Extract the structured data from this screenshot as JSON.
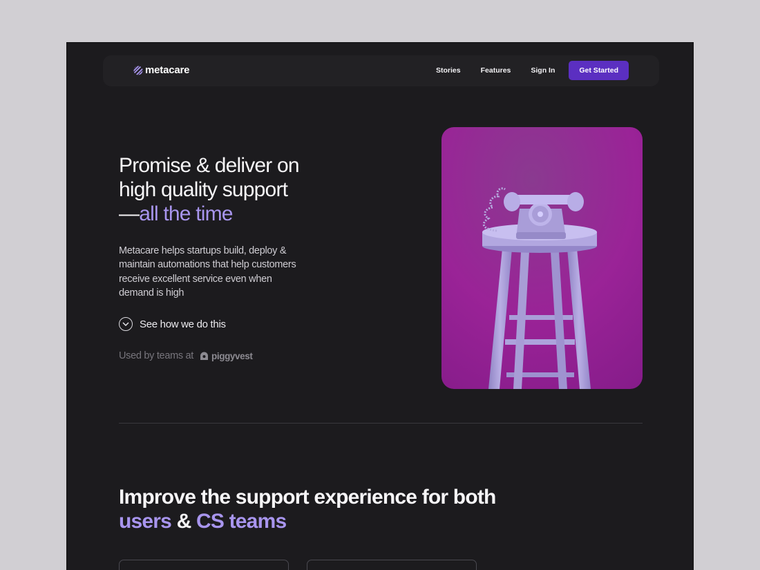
{
  "brand": {
    "name": "metacare"
  },
  "nav": {
    "links": [
      "Stories",
      "Features",
      "Sign In"
    ],
    "cta": "Get Started"
  },
  "hero": {
    "title_line1": "Promise & deliver on",
    "title_line2": "high quality support",
    "title_dash": "—",
    "title_accent": "all the time",
    "description": "Metacare helps startups build, deploy & maintain automations that help customers receive excellent service even when demand is high",
    "see_how": "See how we do this",
    "used_by": "Used by teams at",
    "partner": "piggyvest"
  },
  "section": {
    "title_line1": "Improve the support experience for both",
    "accent1": "users",
    "amp": " & ",
    "accent2": "CS teams"
  },
  "colors": {
    "background": "#1c1b1e",
    "accent": "#a895ee",
    "cta": "#5b2fc1",
    "image_bg": "#9b2399"
  }
}
